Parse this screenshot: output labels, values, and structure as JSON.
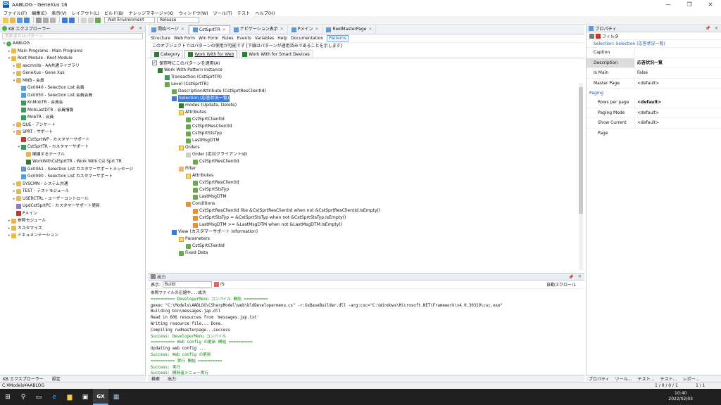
{
  "window": {
    "title": "AABLOG - GeneXus 16",
    "min": "—",
    "max": "❐",
    "close": "✕"
  },
  "menu": [
    "ファイル(F)",
    "編集(E)",
    "表示(V)",
    "レイアウト(L)",
    "ビルド(B)",
    "ナレッジマネージャ(K)",
    "ウィンドウ(W)",
    "ツール(T)",
    "テスト",
    "ヘルプ(H)"
  ],
  "toolbar": {
    "env": ".Net Environment",
    "config": "Release"
  },
  "kb_explorer": {
    "title": "KB エクスプローラー",
    "search_placeholder": "名前またはパターン",
    "items": [
      {
        "label": "AABLOG",
        "lvl": 0,
        "icon": "kb",
        "exp": "▾"
      },
      {
        "label": "Main Programs - Main Programs",
        "lvl": 1,
        "icon": "fold",
        "exp": "▸"
      },
      {
        "label": "Root Module - Root Module",
        "lvl": 1,
        "icon": "fold",
        "exp": "▾"
      },
      {
        "label": "aacmnlib - AA共通ライブラリ",
        "lvl": 2,
        "icon": "fold",
        "exp": "▸"
      },
      {
        "label": "GeneXus - Gene Xus",
        "lvl": 2,
        "icon": "fold",
        "exp": "▸"
      },
      {
        "label": "MNB - 会員",
        "lvl": 2,
        "icon": "fold",
        "exp": "▾"
      },
      {
        "label": "Gx0040 - Selection List 会員",
        "lvl": 3,
        "icon": "obj",
        "exp": ""
      },
      {
        "label": "Gx0050 - Selection List 会員会員",
        "lvl": 3,
        "icon": "obj",
        "exp": ""
      },
      {
        "label": "KnMnbTR - 会員会",
        "lvl": 3,
        "icon": "trn",
        "exp": ""
      },
      {
        "label": "MnbLastDTR - 会員情報",
        "lvl": 3,
        "icon": "trn",
        "exp": ""
      },
      {
        "label": "MnbTR - 会員",
        "lvl": 3,
        "icon": "trn",
        "exp": ""
      },
      {
        "label": "QUE - アンケート",
        "lvl": 2,
        "icon": "fold",
        "exp": "▸"
      },
      {
        "label": "SPRT - サポート",
        "lvl": 2,
        "icon": "fold",
        "exp": "▾"
      },
      {
        "label": "CstSprtWP - カスタマーサポート",
        "lvl": 3,
        "icon": "wp",
        "exp": ""
      },
      {
        "label": "CstSprtTR - カスタマーサポート",
        "lvl": 3,
        "icon": "trn",
        "exp": "▾"
      },
      {
        "label": "関連するテーブル",
        "lvl": 4,
        "icon": "fold",
        "exp": ""
      },
      {
        "label": "WorkWithCstSprtTR - Work With Cst Sprt TR",
        "lvl": 4,
        "icon": "pat",
        "exp": ""
      },
      {
        "label": "Gx00A1 - Selection List カスタマーサポートメッセージ",
        "lvl": 3,
        "icon": "obj",
        "exp": ""
      },
      {
        "label": "Gx0090 - Selection List カスタマーサポート",
        "lvl": 3,
        "icon": "obj",
        "exp": ""
      },
      {
        "label": "SYSCMN - システム共通",
        "lvl": 2,
        "icon": "fold",
        "exp": "▸"
      },
      {
        "label": "TEST - テストモジュール",
        "lvl": 2,
        "icon": "fold",
        "exp": "▸"
      },
      {
        "label": "USERCTRL - ユーザーコントロール",
        "lvl": 2,
        "icon": "fold",
        "exp": "▸"
      },
      {
        "label": "UpdCstSprtPC - カスタマーサポート更新",
        "lvl": 2,
        "icon": "proc",
        "exp": ""
      },
      {
        "label": "Pメイン",
        "lvl": 2,
        "icon": "wp",
        "exp": ""
      },
      {
        "label": "参照モジュール",
        "lvl": 1,
        "icon": "fold",
        "exp": "▸"
      },
      {
        "label": "カスタマイズ",
        "lvl": 1,
        "icon": "fold",
        "exp": "▸"
      },
      {
        "label": "ドキュメンテーション",
        "lvl": 1,
        "icon": "fold",
        "exp": "▸"
      }
    ]
  },
  "left_tabs": [
    "KB エクスプローラー",
    "設定"
  ],
  "doc_tabs": [
    {
      "label": "開始ページ"
    },
    {
      "label": "CstSprtTR",
      "active": true
    },
    {
      "label": "ナビゲーション表示"
    },
    {
      "label": "Pメイン"
    },
    {
      "label": "RwdMasterPage"
    }
  ],
  "sub_tabs": [
    "Structure",
    "Web Form",
    "Win Form",
    "Rules",
    "Events",
    "Variables",
    "Help",
    "Documentation",
    "Patterns"
  ],
  "notice": "このオブジェクトではパターンの使用が可能です [下線はパターンが適用済みであることを示します]",
  "pattern_tabs": [
    "Category",
    "Work With for Web",
    "Work With for Smart Devices"
  ],
  "save_check": "保存時にこのパターンを適用(A)",
  "pattern_tree": [
    {
      "label": "Work With Pattern Instance",
      "lvl": 0,
      "icon": "pat"
    },
    {
      "label": "Transaction (CstSprtTR)",
      "lvl": 1,
      "icon": "trn"
    },
    {
      "label": "Level (CstSprtTR)",
      "lvl": 1,
      "icon": "lvl"
    },
    {
      "label": "DescriptionAttribute (CstSprtResClientId)",
      "lvl": 2,
      "icon": "att"
    },
    {
      "label": "Selection (応答状況一覧)",
      "lvl": 2,
      "icon": "view",
      "sel": true
    },
    {
      "label": "modes (Update, Delete)",
      "lvl": 3,
      "icon": "pat"
    },
    {
      "label": "Attributes",
      "lvl": 3,
      "icon": "fld"
    },
    {
      "label": "CstSprtClientId",
      "lvl": 4,
      "icon": "att"
    },
    {
      "label": "CstSprtResClientId",
      "lvl": 4,
      "icon": "att"
    },
    {
      "label": "CstSprtStsTyp",
      "lvl": 4,
      "icon": "att"
    },
    {
      "label": "LastMsgDTM",
      "lvl": 4,
      "icon": "att"
    },
    {
      "label": "Orders",
      "lvl": 3,
      "icon": "fld"
    },
    {
      "label": "Order (応対クライアントId)",
      "lvl": 4,
      "icon": "ord"
    },
    {
      "label": "CstSprtResClientId",
      "lvl": 5,
      "icon": "att"
    },
    {
      "label": "Filter",
      "lvl": 3,
      "icon": "fil"
    },
    {
      "label": "Attributes",
      "lvl": 4,
      "icon": "fld"
    },
    {
      "label": "CstSprtResClientId",
      "lvl": 5,
      "icon": "att"
    },
    {
      "label": "CstSprtStsTyp",
      "lvl": 5,
      "icon": "att"
    },
    {
      "label": "LastMsgDTM",
      "lvl": 5,
      "icon": "att"
    },
    {
      "label": "Conditions",
      "lvl": 4,
      "icon": "cnd"
    },
    {
      "label": "CstSprtResClientId like &CstSprtResClientId when not &CstSprtResClientId.IsEmpty()",
      "lvl": 5,
      "icon": "cnd"
    },
    {
      "label": "CstSprtStsTyp = &CstSprtStsTyp when not &CstSprtStsTyp.IsEmpty()",
      "lvl": 5,
      "icon": "cnd"
    },
    {
      "label": "LastMsgDTM >= &LastMsgDTM when not &LastMsgDTM.IsEmpty()",
      "lvl": 5,
      "icon": "cnd"
    },
    {
      "label": "View (カスタマーサポート Information)",
      "lvl": 2,
      "icon": "view"
    },
    {
      "label": "Parameters",
      "lvl": 3,
      "icon": "fld"
    },
    {
      "label": "CstSprtClientId",
      "lvl": 4,
      "icon": "att"
    },
    {
      "label": "Fixed Data",
      "lvl": 3,
      "icon": "att"
    }
  ],
  "output": {
    "title": "出力",
    "show_label": "表示:",
    "source": "Build",
    "search": "IS",
    "autoscroll": "自動スクロール",
    "lines": [
      {
        "t": "参照ファイルの圧縮中...成功",
        "c": ""
      },
      {
        "t": "========== DeveloperMenu コンパイル 開始 ==========",
        "c": "green"
      },
      {
        "t": "gexec \"C:\\Models\\AABLOG\\CSharpModel\\web\\bldDevelopermenu.cs\" -r:GxBaseBuilder.dll -arg:csc=\"C:\\Windows\\Microsoft.NET\\Framework\\v4.0.30319\\csc.exe\"",
        "c": ""
      },
      {
        "t": "Building bin\\messages.jap.dll",
        "c": ""
      },
      {
        "t": "Read in 606 resources from 'messages.jap.txt'",
        "c": ""
      },
      {
        "t": "Writing resource file... Done.",
        "c": ""
      },
      {
        "t": "Compiling rwdmasterpage...success",
        "c": ""
      },
      {
        "t": "Success: DeveloperMenu コンパイル",
        "c": "green"
      },
      {
        "t": "========== Web config の更新 開始 ==========",
        "c": "green"
      },
      {
        "t": "Updating web config ...",
        "c": ""
      },
      {
        "t": "Success: Web config の更新",
        "c": "green"
      },
      {
        "t": "========== 実行 開始 ==========",
        "c": "green"
      },
      {
        "t": "Success: 実行",
        "c": "green"
      },
      {
        "t": "Success: 開発者メニュー実行",
        "c": "green"
      }
    ]
  },
  "output_tabs": [
    "検索",
    "出力"
  ],
  "properties": {
    "title": "プロパティ",
    "filter": "フィルタ",
    "selection": "Selection: Selection (応答状況一覧)",
    "rows": [
      {
        "k": "Caption",
        "v": ""
      },
      {
        "k": "Description",
        "v": "応答状況一覧",
        "hl": true
      },
      {
        "k": "Is Main",
        "v": "False"
      },
      {
        "k": "Master Page",
        "v": "<default>"
      }
    ],
    "group": "Paging",
    "paging": [
      {
        "k": "Rows per page",
        "v": "<default>",
        "b": true
      },
      {
        "k": "Paging Mode",
        "v": "<default>"
      },
      {
        "k": "Show Current Page",
        "v": "<default>"
      }
    ]
  },
  "right_tabs": [
    "プロパティ",
    "ツール…",
    "テスト…",
    "テスト…",
    "レポー…"
  ],
  "status": {
    "path": "C:¥Models¥AABLOG",
    "pos": "1 / 0 / 0 / 1",
    "col": "1 / 1"
  },
  "clock": {
    "time": "10:40",
    "date": "2022/02/03"
  }
}
